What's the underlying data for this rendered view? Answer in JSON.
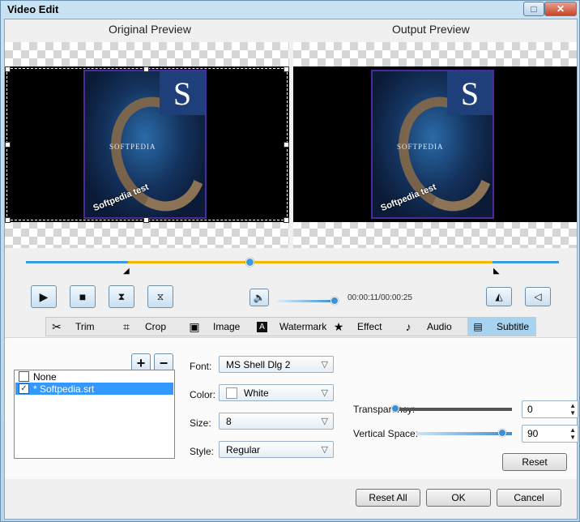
{
  "window": {
    "title": "Video Edit",
    "maximize_icon": "maximize-icon",
    "close_icon": "close-icon"
  },
  "preview": {
    "original_title": "Original Preview",
    "output_title": "Output Preview",
    "logo_letter": "S",
    "brand_text": "SOFTPEDIA",
    "overlay_text": "Softpedia test"
  },
  "timeline": {
    "progress": 0.42,
    "time": "00:00:11/00:00:25",
    "volume_level": 1.0
  },
  "tabs": [
    {
      "label": "Trim",
      "icon": "scissors-icon"
    },
    {
      "label": "Crop",
      "icon": "crop-icon"
    },
    {
      "label": "Image",
      "icon": "image-icon"
    },
    {
      "label": "Watermark",
      "icon": "watermark-icon"
    },
    {
      "label": "Effect",
      "icon": "star-icon"
    },
    {
      "label": "Audio",
      "icon": "music-note-icon"
    },
    {
      "label": "Subtitle",
      "icon": "subtitle-icon",
      "active": true
    }
  ],
  "subtitle": {
    "list": [
      {
        "label": "None",
        "checked": false
      },
      {
        "label": "* Softpedia.srt",
        "checked": true,
        "selected": true
      }
    ],
    "font_label": "Font:",
    "font_value": "MS Shell Dlg 2",
    "color_label": "Color:",
    "color_value": "White",
    "color_hex": "#ffffff",
    "size_label": "Size:",
    "size_value": "8",
    "style_label": "Style:",
    "style_value": "Regular",
    "transparency_label": "Transparency:",
    "transparency_value": "0",
    "transparency_level": 0.0,
    "vspace_label": "Vertical Space:",
    "vspace_value": "90",
    "vspace_level": 0.9,
    "reset_label": "Reset"
  },
  "footer": {
    "reset_all": "Reset All",
    "ok": "OK",
    "cancel": "Cancel"
  },
  "colors": {
    "accent": "#3399ff",
    "timeline_played": "#3d9be0",
    "timeline_range": "#f5b400"
  }
}
